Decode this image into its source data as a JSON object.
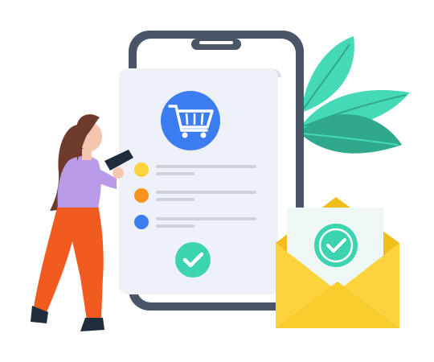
{
  "illustration": {
    "icons": [
      "shopping-cart-icon",
      "checkmark-icon",
      "envelope-icon",
      "leaf-icon",
      "tablet-icon"
    ],
    "checklist": {
      "bullets": [
        {
          "color": "#FDD33D"
        },
        {
          "color": "#F7931E"
        },
        {
          "color": "#3B7DF0"
        }
      ]
    },
    "colors": {
      "phone_frame": "#4A5568",
      "phone_screen": "#FFFFFF",
      "receipt": "#EEF1F7",
      "cart_badge": "#3B7DF0",
      "check_badge": "#3CD3B0",
      "leaf_primary": "#46D9B8",
      "leaf_dark": "#2FA88C",
      "envelope_body": "#FDD33D",
      "envelope_shade": "#F1BD1A",
      "letter": "#EEF6F6",
      "person_top": "#B89AE8",
      "person_pants": "#F25B20",
      "person_hair": "#6E3A2C",
      "person_skin": "#F4C6B0",
      "person_shoe": "#1E2C3C"
    }
  }
}
